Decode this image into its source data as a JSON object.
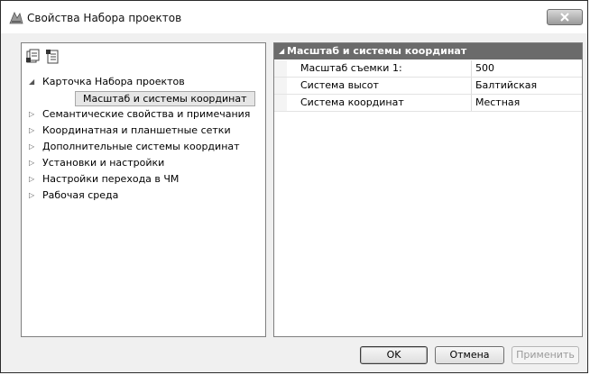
{
  "window": {
    "title": "Свойства Набора проектов",
    "close_symbol": "X"
  },
  "toolbar": {
    "icons": [
      "collapse-all-icon",
      "expand-all-icon"
    ]
  },
  "tree": {
    "items": [
      {
        "label": "Карточка Набора проектов",
        "expanded": true
      },
      {
        "label": "Масштаб и системы координат",
        "selected": true
      },
      {
        "label": "Семантические свойства и примечания",
        "expanded": false
      },
      {
        "label": "Координатная и планшетные сетки",
        "expanded": false
      },
      {
        "label": "Дополнительные системы координат",
        "expanded": false
      },
      {
        "label": "Установки и настройки",
        "expanded": false
      },
      {
        "label": "Настройки перехода в ЧМ",
        "expanded": false
      },
      {
        "label": "Рабочая среда",
        "expanded": false
      }
    ]
  },
  "properties": {
    "category": "Масштаб и системы координат",
    "rows": [
      {
        "name": "Масштаб съемки 1:",
        "value": "500"
      },
      {
        "name": "Система высот",
        "value": "Балтийская"
      },
      {
        "name": "Система координат",
        "value": "Местная"
      }
    ]
  },
  "buttons": {
    "ok": "OK",
    "cancel": "Отмена",
    "apply": "Применить"
  },
  "colors": {
    "category_header_bg": "#6b6b6b",
    "selection_bg": "#e6e6e6"
  }
}
